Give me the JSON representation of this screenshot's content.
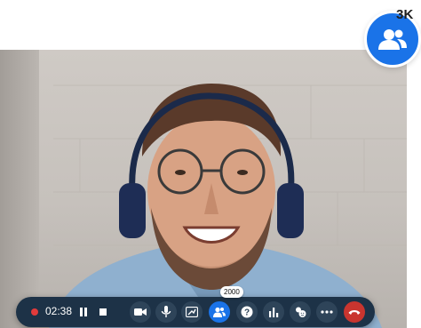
{
  "participants": {
    "count_label": "3K",
    "icon": "people-icon"
  },
  "call": {
    "recording_indicator": "recording-dot-icon",
    "timer": "02:38",
    "participant_count": "2000"
  },
  "toolbar": {
    "buttons": [
      {
        "name": "pause-button",
        "icon": "pause-icon"
      },
      {
        "name": "stop-button",
        "icon": "stop-icon"
      },
      {
        "name": "video-button",
        "icon": "video-camera-icon"
      },
      {
        "name": "microphone-button",
        "icon": "microphone-icon"
      },
      {
        "name": "share-screen-button",
        "icon": "share-screen-icon"
      },
      {
        "name": "participants-button",
        "icon": "people-icon",
        "active": true
      },
      {
        "name": "help-button",
        "icon": "question-icon"
      },
      {
        "name": "polls-button",
        "icon": "bar-chart-icon"
      },
      {
        "name": "reactions-button",
        "icon": "reactions-icon"
      },
      {
        "name": "more-button",
        "icon": "more-icon"
      },
      {
        "name": "end-call-button",
        "icon": "hang-up-icon"
      }
    ]
  },
  "colors": {
    "accent": "#1a73e8",
    "toolbar_bg": "#1d3247",
    "end_call": "#c9352f",
    "recording": "#e23b3b"
  }
}
